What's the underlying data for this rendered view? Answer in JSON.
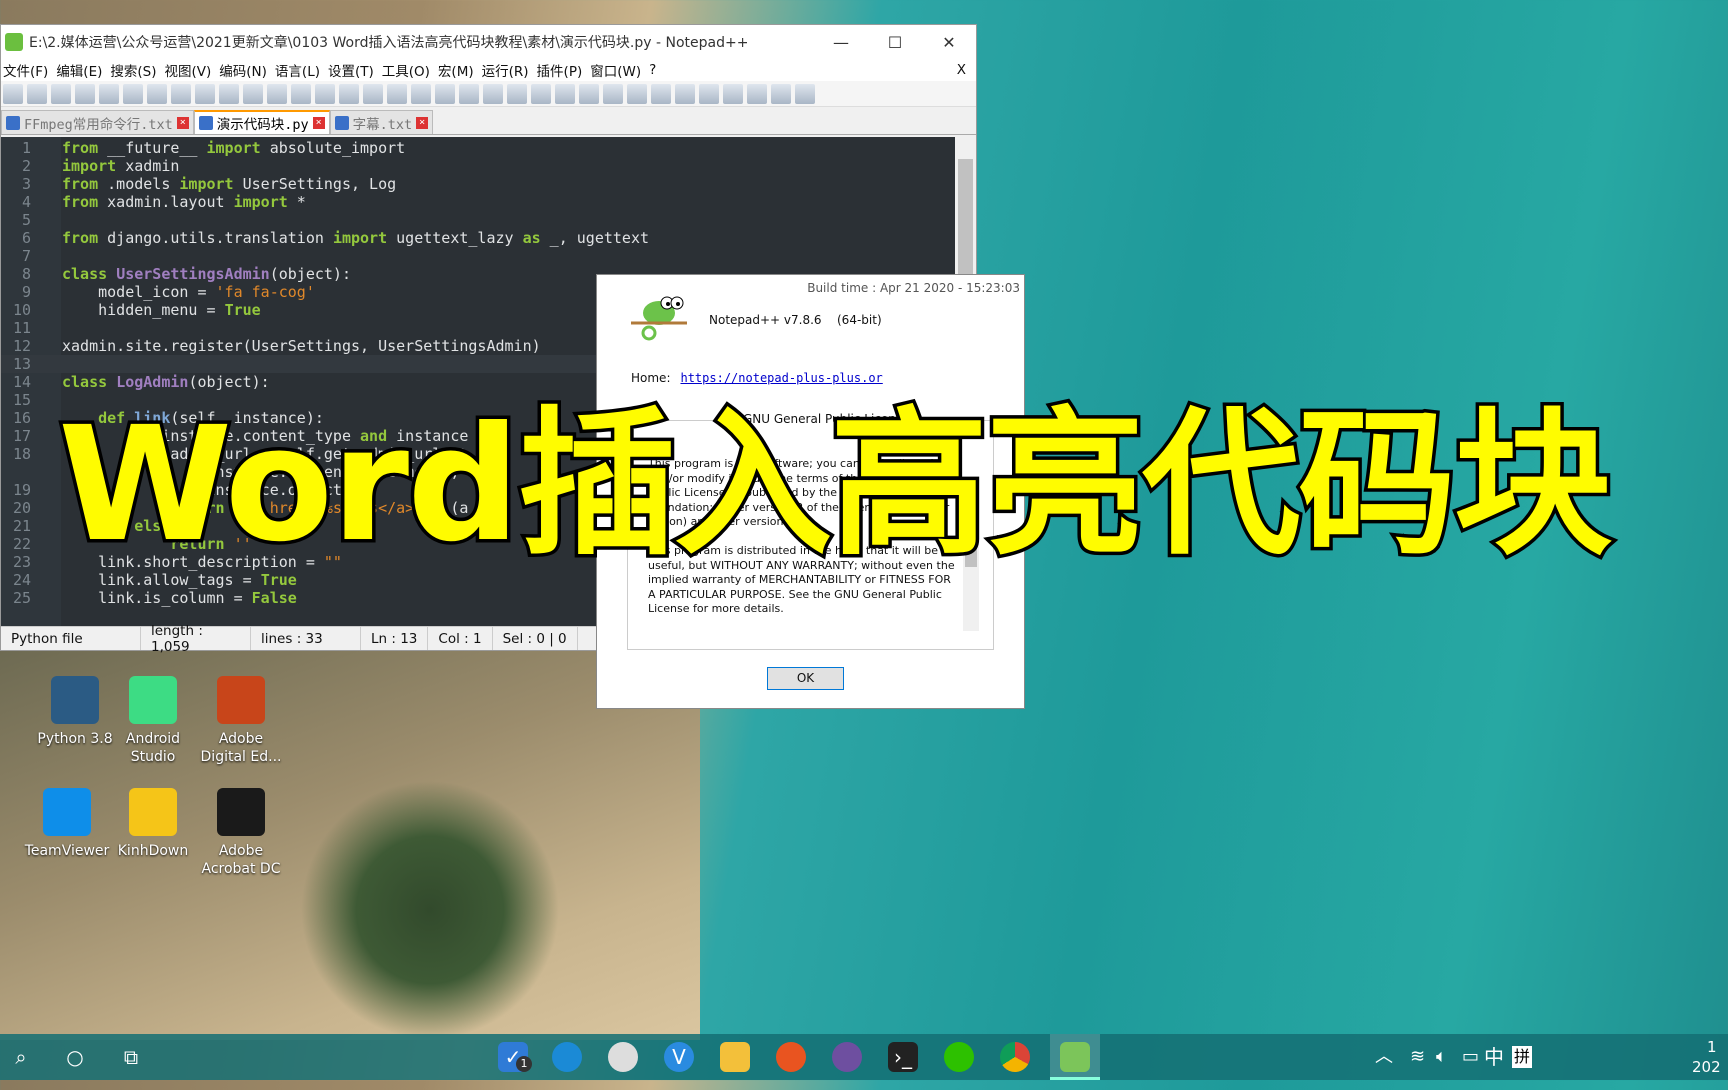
{
  "window": {
    "title": "E:\\2.媒体运营\\公众号运营\\2021更新文章\\0103 Word插入语法高亮代码块教程\\素材\\演示代码块.py - Notepad++",
    "minimize": "—",
    "maximize": "☐",
    "close": "✕",
    "menu_close": "X"
  },
  "menu": [
    "文件(F)",
    "编辑(E)",
    "搜索(S)",
    "视图(V)",
    "编码(N)",
    "语言(L)",
    "设置(T)",
    "工具(O)",
    "宏(M)",
    "运行(R)",
    "插件(P)",
    "窗口(W)",
    "?"
  ],
  "tabs": [
    {
      "label": "FFmpeg常用命令行.txt",
      "active": false
    },
    {
      "label": "演示代码块.py",
      "active": true
    },
    {
      "label": "字幕.txt",
      "active": false
    }
  ],
  "code": [
    {
      "n": "1",
      "t": "from __future__ import absolute_import"
    },
    {
      "n": "2",
      "t": "import xadmin"
    },
    {
      "n": "3",
      "t": "from .models import UserSettings, Log"
    },
    {
      "n": "4",
      "t": "from xadmin.layout import *"
    },
    {
      "n": "5",
      "t": ""
    },
    {
      "n": "6",
      "t": "from django.utils.translation import ugettext_lazy as _, ugettext"
    },
    {
      "n": "7",
      "t": ""
    },
    {
      "n": "8",
      "t": "class UserSettingsAdmin(object):"
    },
    {
      "n": "9",
      "t": "    model_icon = 'fa fa-cog'"
    },
    {
      "n": "10",
      "t": "    hidden_menu = True"
    },
    {
      "n": "11",
      "t": ""
    },
    {
      "n": "12",
      "t": "xadmin.site.register(UserSettings, UserSettingsAdmin)"
    },
    {
      "n": "13",
      "t": ""
    },
    {
      "n": "14",
      "t": "class LogAdmin(object):"
    },
    {
      "n": "15",
      "t": ""
    },
    {
      "n": "16",
      "t": "    def link(self, instance):"
    },
    {
      "n": "17",
      "t": "        if instance.content_type and instance"
    },
    {
      "n": "18",
      "t": "            admin_url = self.get_admin_url('%"
    },
    {
      "n": "",
      "t": "                instance.content_type.model,"
    },
    {
      "n": "19",
      "t": "                instance.object_id)"
    },
    {
      "n": "20",
      "t": "            return \"<a href='%s'>%s</a>\" % (a"
    },
    {
      "n": "21",
      "t": "        else:"
    },
    {
      "n": "22",
      "t": "            return ''"
    },
    {
      "n": "23",
      "t": "    link.short_description = \"\""
    },
    {
      "n": "24",
      "t": "    link.allow_tags = True"
    },
    {
      "n": "25",
      "t": "    link.is_column = False"
    }
  ],
  "status": {
    "type": "Python file",
    "length": "length : 1,059",
    "lines": "lines : 33",
    "ln": "Ln : 13",
    "col": "Col : 1",
    "sel": "Sel : 0 | 0"
  },
  "about": {
    "build": "Build time : Apr 21 2020 - 15:23:03",
    "version": "Notepad++ v7.8.6",
    "bits": "(64-bit)",
    "home_label": "Home:",
    "home_url": "https://notepad-plus-plus.or",
    "gnu_title": "GNU General Public Licence",
    "gnu_p1": "This program is free software; you can redistribute it and/or modify it under the terms of the GNU General Public License as published by the Free Software Foundation; either version 2 of the License, or (at your option) any later version.",
    "gnu_p2": "This program is distributed in the hope that it will be useful, but WITHOUT ANY WARRANTY; without even the implied warranty of MERCHANTABILITY or FITNESS FOR A PARTICULAR PURPOSE.  See the GNU General Public License for more details.",
    "ok": "OK"
  },
  "desktop_icons": [
    {
      "label": "Python 3.8",
      "color": "#2b5b84"
    },
    {
      "label": "Android Studio",
      "color": "#3ddc84"
    },
    {
      "label": "Adobe Digital Ed...",
      "color": "#c8451a"
    },
    {
      "label": "TeamViewer",
      "color": "#0e8ee9"
    },
    {
      "label": "KinhDown",
      "color": "#f5c518"
    },
    {
      "label": "Adobe Acrobat DC",
      "color": "#1a1a1a"
    }
  ],
  "overlay_title": "Word插入高亮代码块",
  "taskbar": {
    "badge": "1",
    "tray_ime1": "中",
    "tray_ime2": "拼",
    "clock_time": "1",
    "clock_date": "202"
  },
  "colors": {
    "keyword": "#94c83d",
    "class_name": "#a07fc0",
    "string": "#e0882a",
    "overlay": "#fffc00",
    "editor_bg": "#2b3035"
  }
}
